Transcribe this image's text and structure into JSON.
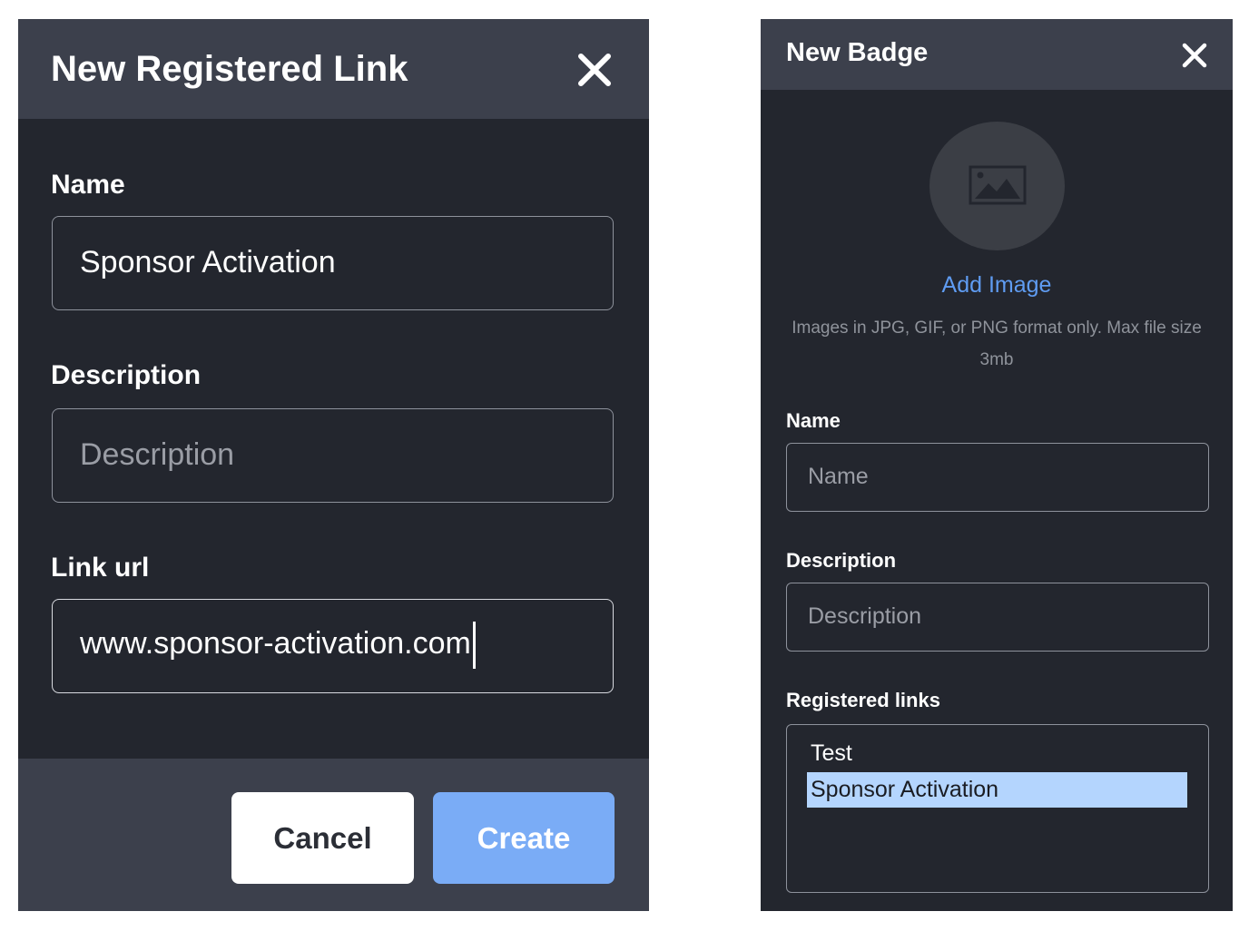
{
  "registered_link_modal": {
    "title": "New Registered Link",
    "name_label": "Name",
    "name_value": "Sponsor Activation",
    "description_label": "Description",
    "description_placeholder": "Description",
    "link_label": "Link url",
    "link_value": "www.sponsor-activation.com",
    "cancel_label": "Cancel",
    "create_label": "Create"
  },
  "badge_modal": {
    "title": "New Badge",
    "add_image_label": "Add Image",
    "image_hint": "Images in JPG, GIF, or PNG format only. Max file size 3mb",
    "name_label": "Name",
    "name_placeholder": "Name",
    "description_label": "Description",
    "description_placeholder": "Description",
    "registered_links_label": "Registered links",
    "registered_links": [
      "Test",
      "Sponsor Activation"
    ],
    "selected_link": "Sponsor Activation"
  },
  "colors": {
    "modal_bg": "#23262e",
    "header_bg": "#3c404c",
    "accent": "#7aacf6",
    "link": "#5f9cf2",
    "selection": "#b4d5fe"
  },
  "icons": [
    "close-icon",
    "image-placeholder-icon"
  ]
}
